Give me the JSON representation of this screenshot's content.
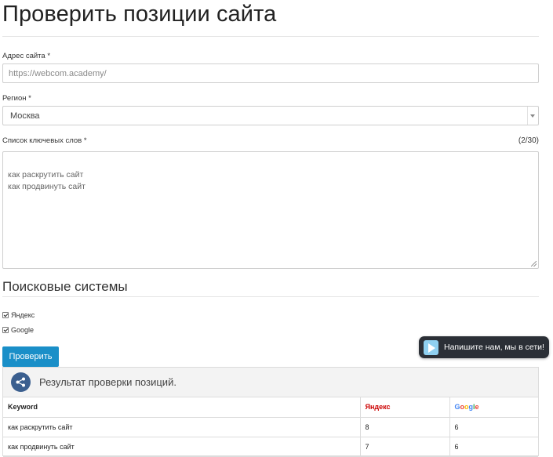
{
  "page": {
    "title": "Проверить позиции сайта"
  },
  "form": {
    "url_label": "Адрес сайта",
    "url_value": "https://webcom.academy/",
    "region_label": "Регион",
    "region_value": "Москва",
    "keywords_label": "Список ключевых слов",
    "keywords_counter": "(2/30)",
    "keywords_value": "как раскрутить сайт\nкак продвинуть сайт",
    "required_mark": "*"
  },
  "engines": {
    "heading": "Поисковые системы",
    "items": [
      {
        "label": "Яндекс",
        "checked": true
      },
      {
        "label": "Google",
        "checked": true
      }
    ]
  },
  "submit_label": "Проверить",
  "chat_widget": {
    "text": "Напишите нам, мы в сети!",
    "icon": "chat-play-icon"
  },
  "result": {
    "title": "Результат проверки позиций.",
    "icon": "share-icon",
    "columns": [
      "Keyword",
      "Яндекс",
      "Google"
    ],
    "rows": [
      {
        "keyword": "как раскрутить сайт",
        "yandex": "8",
        "google": "6"
      },
      {
        "keyword": "как продвинуть сайт",
        "yandex": "7",
        "google": "6"
      }
    ]
  },
  "colors": {
    "button": "#1a8fc8",
    "chat_bg": "#2b2f36",
    "share_icon": "#3b5f8f",
    "yandex_red": "#cc0000"
  }
}
